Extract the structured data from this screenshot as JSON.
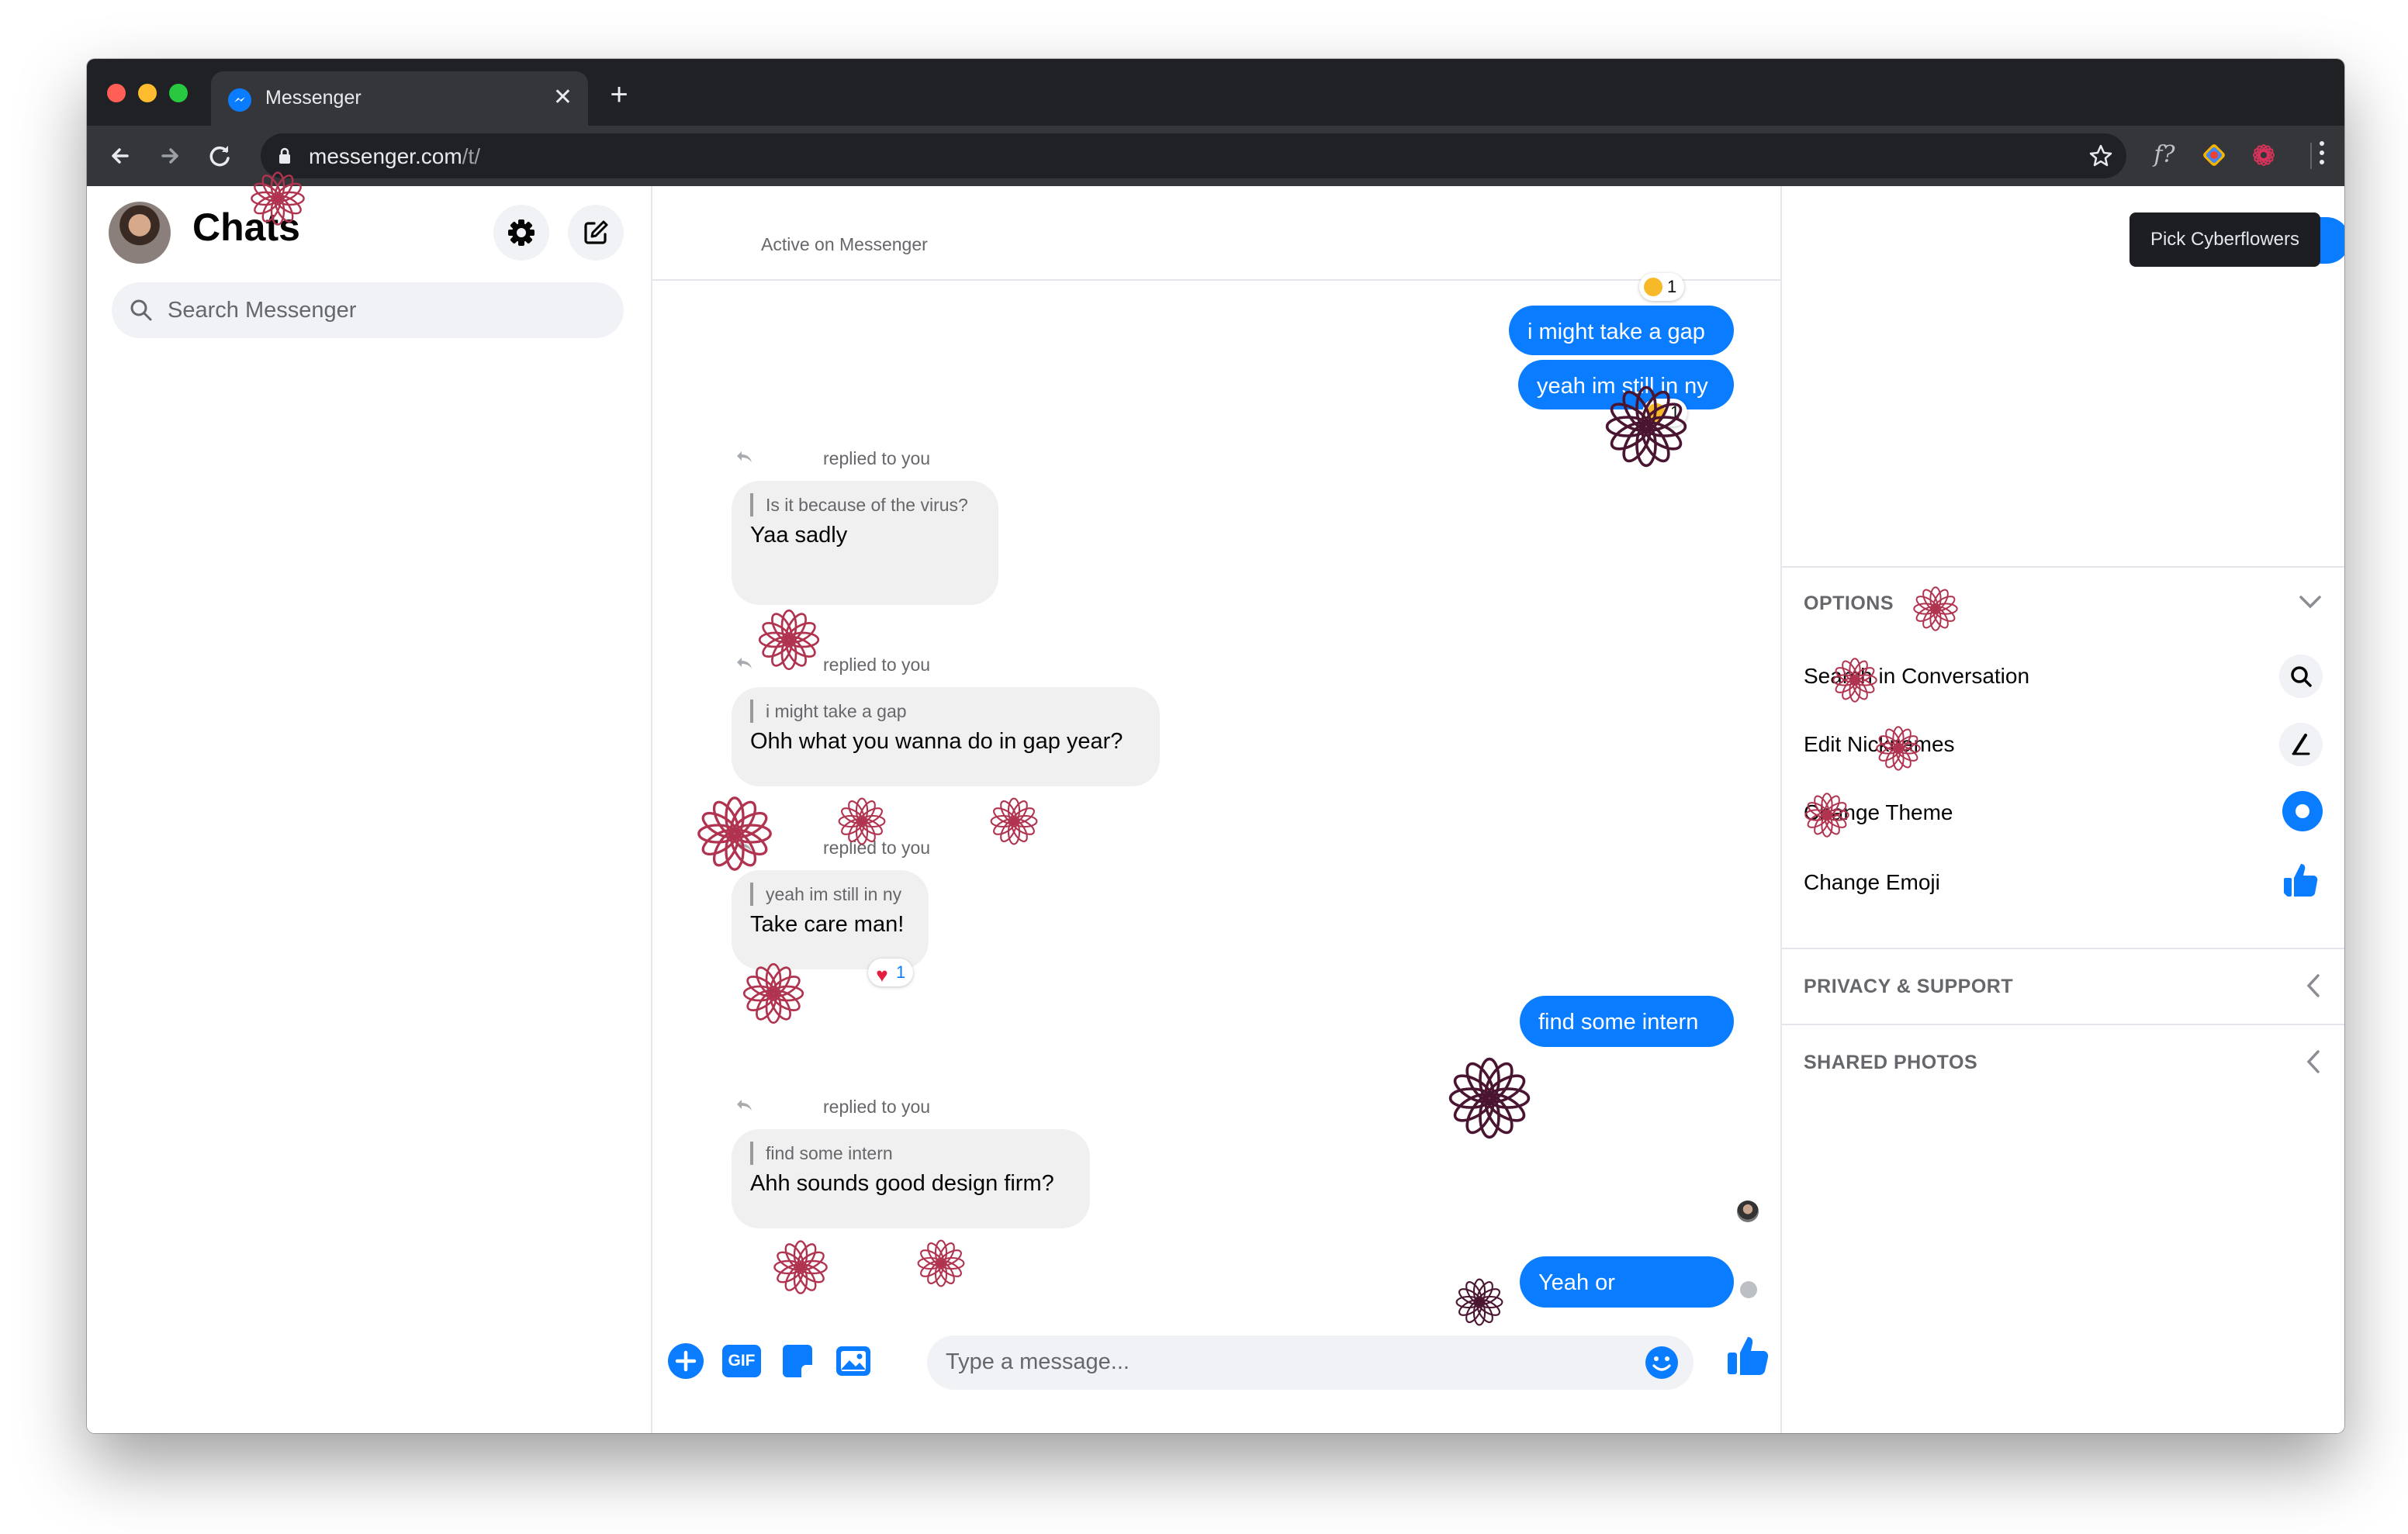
{
  "browser": {
    "tab_title": "Messenger",
    "url_host": "messenger.com",
    "url_path": "/t/",
    "extensions": [
      "f?"
    ]
  },
  "sidebar": {
    "title": "Chats",
    "search_placeholder": "Search Messenger"
  },
  "conversation": {
    "status": "Active on Messenger",
    "messages": [
      {
        "from": "me",
        "text": "i might take a gap"
      },
      {
        "from": "me",
        "text": "yeah im still in ny",
        "reaction": "1"
      },
      {
        "from": "them",
        "replied": "replied to you",
        "quote": "Is it because of the virus?",
        "text": "Yaa sadly"
      },
      {
        "from": "them",
        "replied": "replied to you",
        "quote": "i might take a gap",
        "text": "Ohh what you wanna do in gap year?"
      },
      {
        "from": "them",
        "replied": "replied to you",
        "quote": "yeah im still in ny",
        "text": "Take care man!",
        "reaction": "1"
      },
      {
        "from": "me",
        "text": "find some intern"
      },
      {
        "from": "them",
        "replied": "replied to you",
        "quote": "find some intern",
        "text": "Ahh sounds good design firm?"
      },
      {
        "from": "me",
        "text": "Yeah or"
      }
    ],
    "top_reaction": "1",
    "composer_placeholder": "Type a message...",
    "gif_label": "GIF"
  },
  "details": {
    "tooltip": "Pick Cyberflowers",
    "options_title": "OPTIONS",
    "options": [
      "Search in Conversation",
      "Edit Nicknames",
      "Change Theme",
      "Change Emoji"
    ],
    "privacy_title": "PRIVACY & SUPPORT",
    "shared_photos_title": "SHARED PHOTOS"
  },
  "colors": {
    "messenger_blue": "#0a7cff",
    "flower": "#b0334f",
    "flower_dark": "#4a1530"
  }
}
